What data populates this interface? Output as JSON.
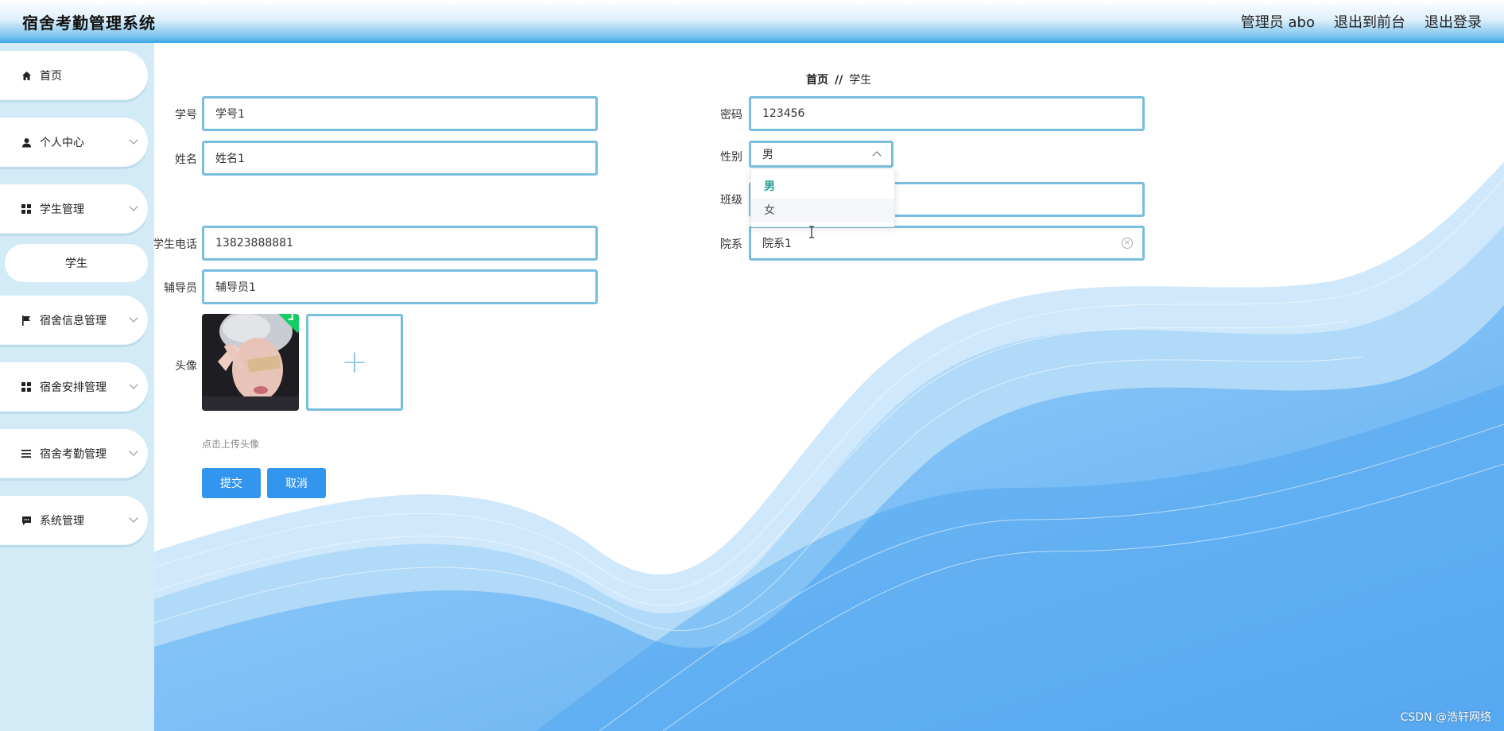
{
  "header": {
    "title": "宿舍考勤管理系统",
    "admin_label": "管理员 abo",
    "back_to_front": "退出到前台",
    "logout": "退出登录"
  },
  "sidebar": {
    "items": [
      {
        "label": "首页",
        "icon": "home-icon"
      },
      {
        "label": "个人中心",
        "icon": "user-icon"
      },
      {
        "label": "学生管理",
        "icon": "grid-icon"
      },
      {
        "label": "宿舍信息管理",
        "icon": "flag-icon"
      },
      {
        "label": "宿舍安排管理",
        "icon": "grid-icon"
      },
      {
        "label": "宿舍考勤管理",
        "icon": "list-icon"
      },
      {
        "label": "系统管理",
        "icon": "chat-icon"
      }
    ],
    "sub_item": "学生"
  },
  "breadcrumb": {
    "home": "首页",
    "separator": "//",
    "current": "学生"
  },
  "form": {
    "student_id": {
      "label": "学号",
      "value": "学号1"
    },
    "name": {
      "label": "姓名",
      "value": "姓名1"
    },
    "phone": {
      "label": "学生电话",
      "value": "13823888881"
    },
    "counselor": {
      "label": "辅导员",
      "value": "辅导员1"
    },
    "avatar": {
      "label": "头像",
      "hint": "点击上传头像",
      "add_symbol": "+"
    },
    "password": {
      "label": "密码",
      "value": "123456"
    },
    "gender": {
      "label": "性别",
      "value": "男",
      "options": [
        "男",
        "女"
      ]
    },
    "class": {
      "label": "班级",
      "value": ""
    },
    "department": {
      "label": "院系",
      "value": "院系1"
    }
  },
  "buttons": {
    "submit": "提交",
    "cancel": "取消"
  },
  "watermark": "CSDN @浩轩网络",
  "colors": {
    "accent": "#3296ee",
    "field_border": "#78bede",
    "sidebar_bg": "#d3ebf6"
  }
}
